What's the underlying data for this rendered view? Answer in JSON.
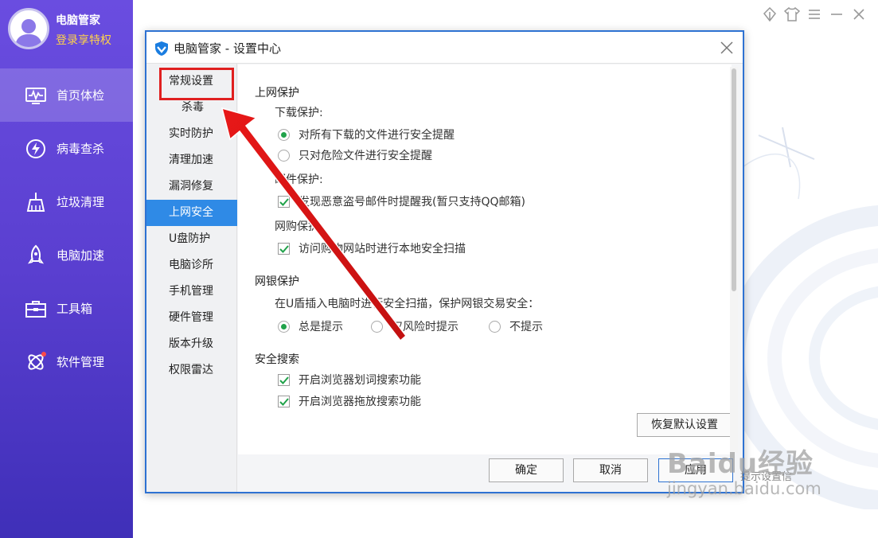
{
  "user": {
    "name": "电脑管家",
    "subtitle": "登录享特权"
  },
  "sidebar": {
    "items": [
      {
        "label": "首页体检",
        "icon": "monitor-pulse-icon",
        "active": true
      },
      {
        "label": "病毒查杀",
        "icon": "lightning-circle-icon"
      },
      {
        "label": "垃圾清理",
        "icon": "broom-icon"
      },
      {
        "label": "电脑加速",
        "icon": "rocket-icon"
      },
      {
        "label": "工具箱",
        "icon": "toolbox-icon"
      },
      {
        "label": "软件管理",
        "icon": "software-cross-icon"
      }
    ]
  },
  "top_icons": [
    "skin-icon",
    "tshirt-icon",
    "menu-icon",
    "minimize-icon",
    "close-icon"
  ],
  "dialog": {
    "title": "电脑管家 - 设置中心",
    "nav": [
      "常规设置",
      "杀毒",
      "实时防护",
      "清理加速",
      "漏洞修复",
      "上网安全",
      "U盘防护",
      "电脑诊所",
      "手机管理",
      "硬件管理",
      "版本升级",
      "权限雷达"
    ],
    "active_nav": "上网安全",
    "sections": {
      "internet": {
        "title": "上网保护",
        "download_title": "下载保护:",
        "download_opt1": "对所有下载的文件进行安全提醒",
        "download_opt2": "只对危险文件进行安全提醒",
        "mail_title": "邮件保护:",
        "mail_opt": "发现恶意盗号邮件时提醒我(暂只支持QQ邮箱)",
        "shop_title": "网购保护:",
        "shop_opt": "访问购物网站时进行本地安全扫描"
      },
      "bank": {
        "title": "网银保护",
        "desc": "在U盾插入电脑时进行安全扫描，保护网银交易安全：",
        "opt1": "总是提示",
        "opt2": "仅风险时提示",
        "opt3": "不提示"
      },
      "search": {
        "title": "安全搜索",
        "opt1": "开启浏览器划词搜索功能",
        "opt2": "开启浏览器拖放搜索功能"
      }
    },
    "buttons": {
      "restore": "恢复默认设置",
      "ok": "确定",
      "cancel": "取消",
      "apply": "应用"
    }
  },
  "behind_text": "提示设置信",
  "watermark": {
    "logo": "Baidu经验",
    "sub": "jingyan.baidu.com"
  },
  "colors": {
    "sidebar": "#5a3fd0",
    "active_nav": "#2f8ae6",
    "radio_on": "#20a24a",
    "highlight": "#e02020"
  }
}
